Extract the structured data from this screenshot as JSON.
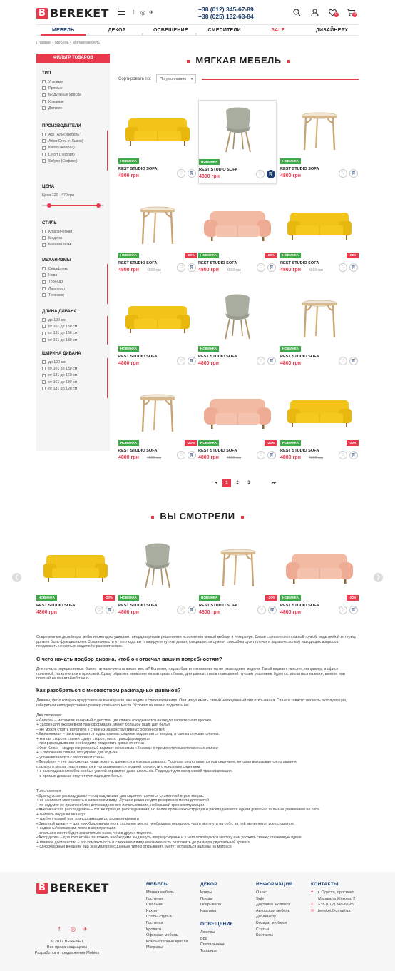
{
  "header": {
    "logo_letter": "B",
    "logo_text": "BEREKET",
    "social": [
      "f",
      "◎",
      "✈"
    ],
    "phones": [
      "+38 (012) 345-67-89",
      "+38 (025) 132-63-84"
    ],
    "wishlist_count": "0",
    "cart_count": "0"
  },
  "nav": [
    {
      "label": "МЕБЕЛЬ",
      "active": true
    },
    {
      "label": "ДЕКОР"
    },
    {
      "label": "ОСВЕЩЕНИЕ"
    },
    {
      "label": "СМЕСИТЕЛИ"
    },
    {
      "label": "SALE",
      "sale": true
    },
    {
      "label": "ДИЗАЙНЕРУ"
    }
  ],
  "breadcrumbs": "Главная  •  Мебель  •  Мягкая мебель",
  "sidebar": {
    "title": "ФИЛЬТР ТОВАРОВ",
    "type": {
      "title": "ТИП",
      "items": [
        "Угловые",
        "Прямые",
        "Модульные кресла",
        "Кожаные",
        "Детские"
      ]
    },
    "makers": {
      "title": "ПРОИЗВОДИТЕЛИ",
      "items": [
        "Alis \"Алис-мебель\"",
        "Arbor Drev (г. Львов)",
        "Kairos (Кайрос)",
        "Lefort (Лефорт)",
        "Sofyno (Софино)"
      ]
    },
    "price": {
      "title": "ЦЕНА",
      "range": "Цена 120 - 470 грн",
      "from_pct": 12,
      "to_pct": 92
    },
    "style": {
      "title": "СТИЛЬ",
      "items": [
        "Классический",
        "Модерн",
        "Минимализм"
      ]
    },
    "mechanism": {
      "title": "МЕХАНИЗМЫ",
      "items": [
        "Седафлекс",
        "Нова",
        "Торнадо",
        "Лампопет",
        "Телескоп"
      ]
    },
    "length": {
      "title": "ДЛИНА ДИВАНА",
      "items": [
        "до 100 см",
        "от 101 до 130 см",
        "от 131 до 160 см",
        "от 161 до 180 см"
      ]
    },
    "width": {
      "title": "ШИРИНА ДИВАНА",
      "items": [
        "до 100 см",
        "от 101 до 130 см",
        "от 131 до 160 см",
        "от 161 до 180 см",
        "от 181 до 190 см"
      ]
    }
  },
  "main": {
    "title": "МЯГКАЯ МЕБЕЛЬ",
    "sort_label": "Сортировать по:",
    "sort_value": "По умолчанию",
    "new_label": "НОВИНКА",
    "products": [
      {
        "kind": "sofa-yellow",
        "name": "REST STUDIO SOFA",
        "price": "4800 грн"
      },
      {
        "kind": "chair",
        "name": "REST STUDIO SOFA",
        "price": "4800 грн",
        "selected": true
      },
      {
        "kind": "stool",
        "name": "REST STUDIO SOFA",
        "price": "4800 грн"
      },
      {
        "kind": "stool",
        "name": "REST STUDIO SOFA",
        "price": "4800 грн",
        "discount": "-20%",
        "old": "4800 грн"
      },
      {
        "kind": "sofa-pink",
        "name": "REST STUDIO SOFA",
        "price": "4800 грн",
        "discount": "-20%",
        "old": "4800 грн"
      },
      {
        "kind": "sofa-yellow",
        "name": "REST STUDIO SOFA",
        "price": "4800 грн",
        "discount": "-20%",
        "old": "4800 грн"
      },
      {
        "kind": "sofa-yellow",
        "name": "REST STUDIO SOFA",
        "price": "4800 грн"
      },
      {
        "kind": "chair",
        "name": "REST STUDIO SOFA",
        "price": "4800 грн"
      },
      {
        "kind": "stool",
        "name": "REST STUDIO SOFA",
        "price": "4800 грн"
      },
      {
        "kind": "stool",
        "name": "REST STUDIO SOFA",
        "price": "4800 грн",
        "discount": "-20%",
        "old": "4800 грн"
      },
      {
        "kind": "sofa-pink",
        "name": "REST STUDIO SOFA",
        "price": "4800 грн",
        "discount": "-20%",
        "old": "4800 грн"
      },
      {
        "kind": "sofa-yellow",
        "name": "REST STUDIO SOFA",
        "price": "4800 грн",
        "discount": "-20%",
        "old": "4800 грн"
      }
    ],
    "pagination": [
      "◂",
      "1",
      "2",
      "3",
      "▸▸"
    ]
  },
  "viewed": {
    "title": "ВЫ СМОТРЕЛИ",
    "products": [
      {
        "kind": "sofa-yellow",
        "name": "REST STUDIO SOFA",
        "price": "4800 грн",
        "discount": "-20%"
      },
      {
        "kind": "chair",
        "name": "REST STUDIO SOFA",
        "price": "4800 грн"
      },
      {
        "kind": "stool",
        "name": "REST STUDIO SOFA",
        "price": "4800 грн",
        "discount": "-20%"
      },
      {
        "kind": "sofa-pink",
        "name": "REST STUDIO SOFA",
        "price": "4800 грн",
        "discount": "-20%"
      }
    ]
  },
  "seo": {
    "intro": "Современные дизайнеры мебели ежегодно удивляют неординарными решениями исполнения мягкой мебели в интерьере. Диван становится оправной точкой, ведь любой интерьер должен быть функционален. В зависимости от того куда вы планируете купить диван, специалисты сумеют способны сузить поиск и задав несколько наводящих вопросов предложить несколько моделей к рассмотрению.",
    "h1": "С чего начать подбор дивана, чтоб он отвечал вашим потребностям?",
    "p1": "Для начала определяемся: Важно ли наличие спального места? Если нет, тогда обратите внимание на не раскладные модели. Такой вариант уместен, например, в офисе, приемной, на кухне или в прихожей. Сразу обратите внимание на материал обивки, для данных типов помещений лучшим решением будет остановиться на коже, винилe или плотной износостойкой ткани.",
    "h2": "Как разобраться с множеством раскладных диванов?",
    "p2": "Диваны, фото которых представлены в интернете, мы видим в сложенном виде. Они могут иметь самый неожиданный тип открывания. От него зависит легкость эксплуатации, габариты и непосредственно размер спального места. Условно их можно поделить на:",
    "list1": [
      "Два сложения:",
      "«Книжка» – механизм знакомый с детства, где спинка откидывается назад до характерного щелчка.",
      "+ Удобен для ежедневной трансформации, имеет большой ящик для белья.",
      "– Не может стоять вплотную к стене из-за конструктивных особенностей.",
      "«Еврокнижка» – раскладывается в два приема: сиденье выдвигается вперед, а спинка опускается вниз.",
      "+ мягкая сторона спинки с двух сторон, легко трансформируется",
      "– при раскладывании необходимо отодвигать диван от стены.",
      "«Клик-Кляк» – модернизированный вариант механизма «Книжка» с промежуточным положение спинки:",
      "+ 3 положения спинки, что удобно для отдыха.",
      "– устанавливается с зазором от стены.",
      "«Дельфин» – тип разложения чаще всего встречается в угловых диванах. Подушка располагается под сиденьем, которая выкатывается по ширине",
      "спального места, подтягивается и устанавливается в одной плоскости с основным сиденьем.",
      "+ с раскладыванием без особых усилий справится даже школьник. Подходит для ежедневной трансформации.",
      "– в прямых диванах отсутствует ящик для белья."
    ],
    "list2": [
      "Три сложения:",
      "«Французская раскладушка» – под подушками для сидения прячется сложенный втрое матрас",
      "+ не занимает много места в сложенном виде. Лучшее решение для резервного места для гостей",
      "– по задумке не приспособлен для ежедневного использования, небольшой срок эксплуатации",
      "«Американская раскладушка» – тот же принцип раскладывания, но более прочная конструкция и раскладывается одним довольно сильным движением на себя.",
      "+ снимать подушки не надо",
      "– требует усилий при трансформации до размера кровати",
      "«Вика́тной диван» – для преобразования его в спальное место, необходимо переднюю часть вытянуть на себя, за ней выпиняется все остальное.",
      "+ надежный механизм, легок в эксплуатации.",
      "– спальное место будет значительно ниже, чем в других моделях.",
      "«Аккордеон» – для того чтобы разложить необходимо выдвинуть вперед сиденье и у него освободится место у ним уложить спинку, сложенную вдвое.",
      "+ главное достоинство – это компактность в сложенном виде и возможность разложить до размера двуспальной кровати.",
      "– однообразный внешний вид экземпляров с данным типом открывания. Могут оставаться заломы на матрасе."
    ]
  },
  "footer": {
    "copyright": "© 2017 BEREKET",
    "rights": "Все права защищены",
    "dev": "Разработка и продвижение Mobios",
    "cols": [
      {
        "title": "МЕБЕЛЬ",
        "items": [
          "Мягкая мебель",
          "Гостиные",
          "Спальни",
          "Кухни",
          "Столы стулья",
          "Гостиная",
          "Кровати",
          "Офисная мебель",
          "Компьютерные кресла",
          "Матрасы"
        ]
      },
      {
        "title": "ДЕКОР",
        "items": [
          "Ковры",
          "Пледы",
          "Покрывала",
          "Картины"
        ]
      },
      {
        "title": "ОСВЕЩЕНИЕ",
        "items": [
          "Люстры",
          "Бра",
          "Светильники",
          "Торшеры"
        ]
      },
      {
        "title": "ИНФОРМАЦИЯ",
        "items": [
          "О нас",
          "Sale",
          "Доставка и оплата",
          "Авторская мебель",
          "Дизайнеру",
          "Возврат и обмен",
          "Статьи",
          "Контакты"
        ]
      },
      {
        "title": "КОНТАКТЫ",
        "items": [
          "г. Одесса, проспект",
          "Маршала Жукова, 2",
          "+38 (012) 345-67-89",
          "bereket@gmail.ua"
        ]
      }
    ]
  },
  "colors": {
    "accent": "#e8394d",
    "navy": "#1b3e6e",
    "green": "#3daa47"
  }
}
